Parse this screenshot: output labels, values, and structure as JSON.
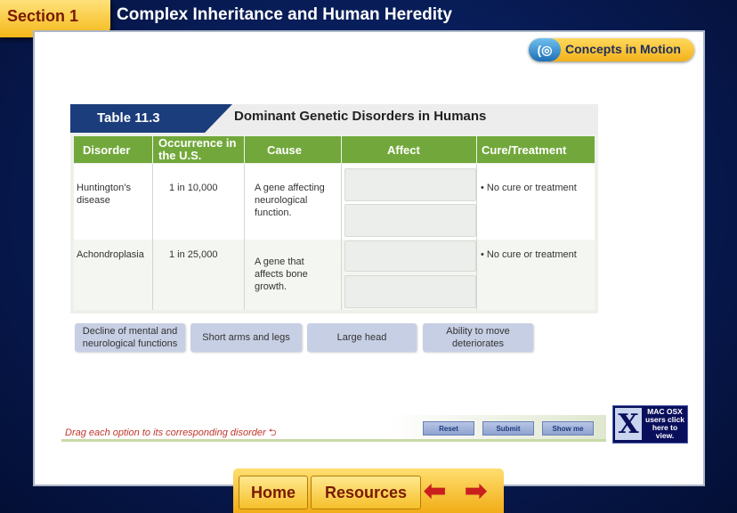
{
  "header": {
    "section_label": "Section 1",
    "title": "Complex Inheritance and Human Heredity"
  },
  "concepts_button": {
    "icon": "(◎",
    "label": "Concepts in Motion"
  },
  "table": {
    "number": "Table 11.3",
    "caption": "Dominant Genetic Disorders in Humans",
    "columns": [
      "Disorder",
      "Occurrence in the U.S.",
      "Cause",
      "Affect",
      "Cure/Treatment"
    ],
    "rows": [
      {
        "disorder": "Huntington’s disease",
        "occurrence": "1 in 10,000",
        "cause": "A gene affecting neurological function.",
        "cure": "• No cure or treatment"
      },
      {
        "disorder": "Achondroplasia",
        "occurrence": "1 in 25,000",
        "cause": "A gene that affects bone growth.",
        "cure": "• No cure or treatment"
      }
    ]
  },
  "options": [
    "Decline of mental and neurological functions",
    "Short arms and legs",
    "Large head",
    "Ability to move deteriorates"
  ],
  "instruction": "Drag each option to its corresponding disorder",
  "controls": {
    "reset": "Reset",
    "submit": "Submit",
    "show_me": "Show me"
  },
  "mac_notice": {
    "icon": "X",
    "text": "MAC OSX users click here to view."
  },
  "nav": {
    "home": "Home",
    "resources": "Resources"
  },
  "colors": {
    "accent_green": "#72a83b",
    "table_blue": "#1c3d7c",
    "nav_gold": "#f4b718"
  }
}
